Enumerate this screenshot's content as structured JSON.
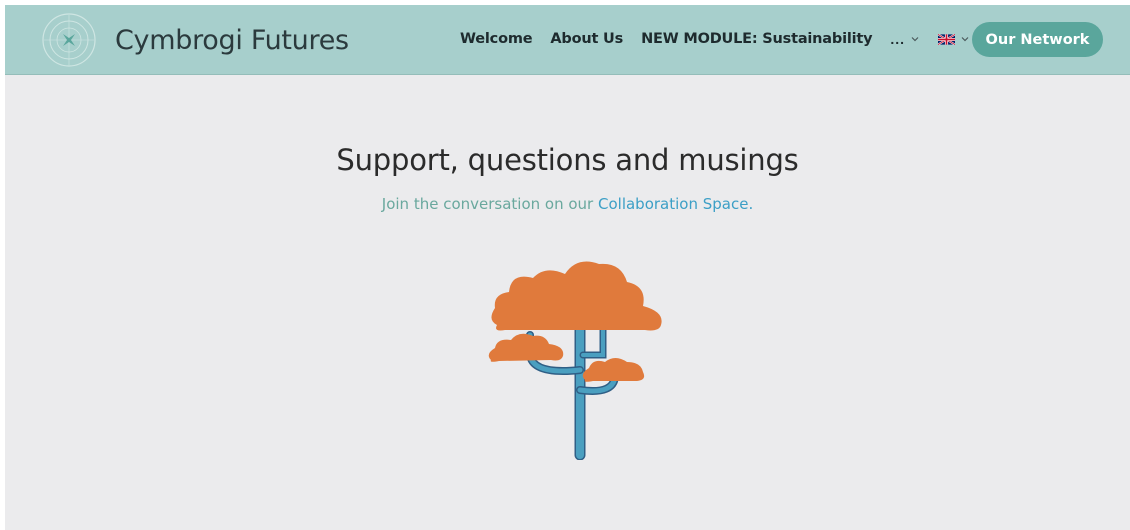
{
  "header": {
    "brand_name": "Cymbrogi Futures",
    "nav": [
      {
        "label": "Welcome"
      },
      {
        "label": "About Us"
      },
      {
        "label": "NEW MODULE: Sustainability"
      }
    ],
    "more_label": "...",
    "language_icon": "uk-flag-icon",
    "cta_label": "Our Network"
  },
  "hero": {
    "title": "Support, questions and musings",
    "subtitle_prefix": "Join the conversation on our ",
    "subtitle_link": "Collaboration Space."
  },
  "colors": {
    "header_bg": "#a7cfcc",
    "cta_bg": "#5aa69c",
    "page_bg": "#ebebed",
    "subtitle_text": "#6aa89e",
    "link": "#3c9fc6",
    "tree_foliage": "#e07a3c",
    "tree_trunk": "#4a9fc0"
  }
}
